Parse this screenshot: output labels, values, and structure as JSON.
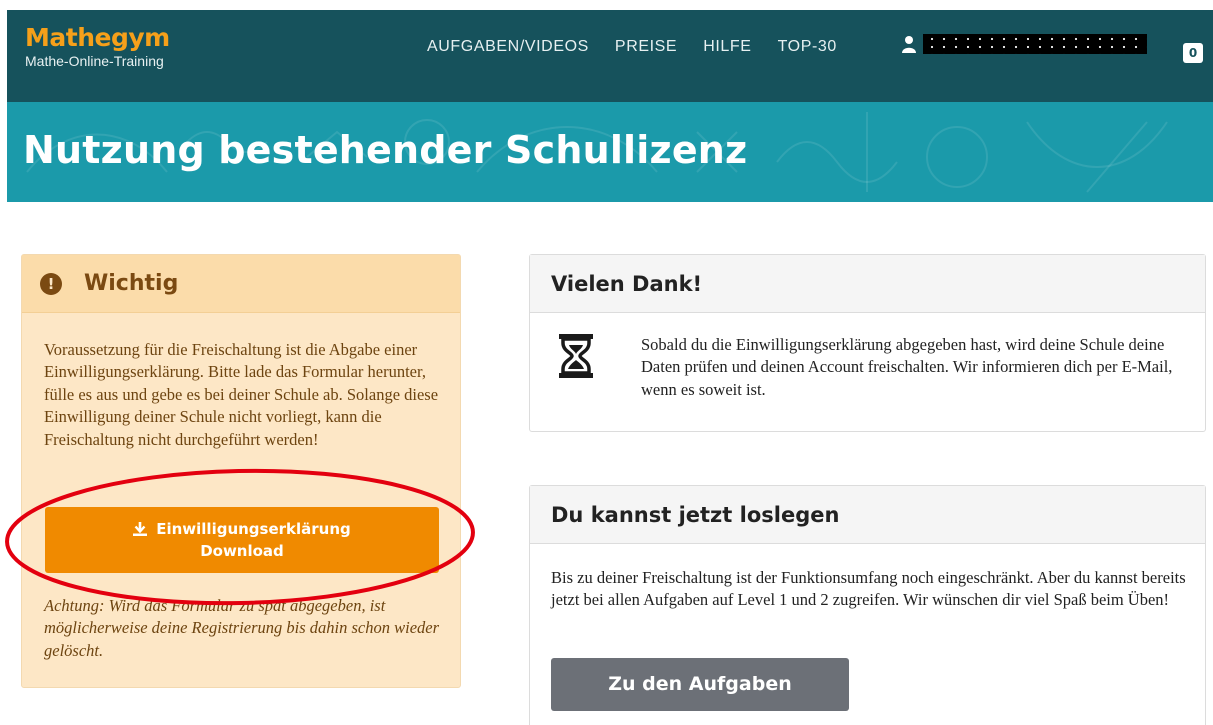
{
  "header": {
    "logo_title": "Mathegym",
    "logo_subtitle": "Mathe-Online-Training",
    "nav": [
      {
        "label": "AUFGABEN/VIDEOS"
      },
      {
        "label": "PREISE"
      },
      {
        "label": "HILFE"
      },
      {
        "label": "TOP-30"
      }
    ],
    "user_name": "",
    "cart_count": "0"
  },
  "hero": {
    "title": "Nutzung bestehender Schullizenz"
  },
  "warning": {
    "title": "Wichtig",
    "body": "Voraussetzung für die Freischaltung ist die Abgabe einer Einwilligungserklärung. Bitte lade das Formular herunter, fülle es aus und gebe es bei deiner Schule ab. Solange diese Einwilligung deiner Schule nicht vorliegt, kann die Freischaltung nicht durchgeführt werden!",
    "download_line1": "Einwilligungserklärung",
    "download_line2": "Download",
    "note": "Achtung: Wird das Formular zu spät abgegeben, ist möglicherweise deine Registrierung bis dahin schon wieder gelöscht."
  },
  "thanks_card": {
    "title": "Vielen Dank!",
    "text": "Sobald du die Einwilligungserklärung abgegeben hast, wird deine Schule deine Daten prüfen und deinen Account freischalten. Wir informieren dich per E-Mail, wenn es soweit ist."
  },
  "start_card": {
    "title": "Du kannst jetzt loslegen",
    "text": "Bis zu deiner Freischaltung ist der Funktionsumfang noch eingeschränkt. Aber du kannst bereits jetzt bei allen Aufgaben auf Level 1 und 2 zugreifen. Wir wünschen dir viel Spaß beim Üben!",
    "button": "Zu den Aufgaben"
  },
  "colors": {
    "nav_bg": "#16525c",
    "hero_bg": "#1b9aaa",
    "logo": "#f6a01a",
    "warning_bg": "#fde7c6",
    "warning_text": "#7b4a12",
    "download_button": "#f08a00",
    "primary_button": "#6c7077",
    "annotation": "#e3000f"
  },
  "icons": {
    "user": "user-icon",
    "warning": "exclamation-circle-icon",
    "download": "download-icon",
    "hourglass": "hourglass-icon"
  }
}
